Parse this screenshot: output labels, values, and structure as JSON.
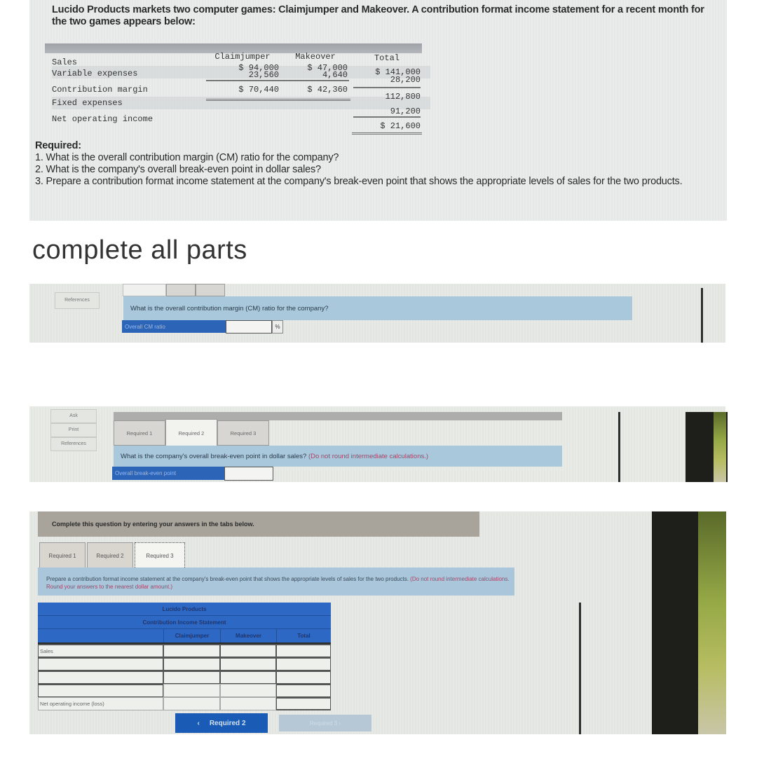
{
  "problem": {
    "intro": "Lucido Products markets two computer games: Claimjumper and Makeover. A contribution format income statement for a recent month for the two games appears below:",
    "statement": {
      "columns": [
        "Claimjumper",
        "Makeover",
        "Total"
      ],
      "rows": [
        {
          "label": "Sales",
          "claimjumper": "$ 94,000",
          "makeover": "$ 47,000",
          "total": "$ 141,000"
        },
        {
          "label": "Variable expenses",
          "claimjumper": "23,560",
          "makeover": "4,640",
          "total": "28,200"
        },
        {
          "label": "Contribution margin",
          "claimjumper": "$ 70,440",
          "makeover": "$ 42,360",
          "total": "112,800"
        },
        {
          "label": "Fixed expenses",
          "claimjumper": "",
          "makeover": "",
          "total": "91,200"
        },
        {
          "label": "Net operating income",
          "claimjumper": "",
          "makeover": "",
          "total": "$ 21,600"
        }
      ]
    },
    "required_heading": "Required:",
    "required_items": [
      "1. What is the overall contribution margin (CM) ratio for the company?",
      "2. What is the company's overall break-even point in dollar sales?",
      "3. Prepare a contribution format income statement at the company's break-even point that shows the appropriate levels of sales for the two products."
    ]
  },
  "caption": "complete all parts",
  "part1": {
    "side_buttons": [
      "References"
    ],
    "question": "What is the overall contribution margin (CM) ratio for the company?",
    "input_label": "Overall CM ratio",
    "input_value": "",
    "unit": "%"
  },
  "part2": {
    "side_buttons": [
      "Ask",
      "Print",
      "References"
    ],
    "tabs": [
      "Required 1",
      "Required 2",
      "Required 3"
    ],
    "active_tab": "Required 2",
    "question": "What is the company's overall break-even point in dollar sales?",
    "note": "(Do not round intermediate calculations.)",
    "input_label": "Overall break-even point",
    "input_value": ""
  },
  "part3": {
    "instruction_bar": "Complete this question by entering your answers in the tabs below.",
    "tabs": [
      "Required 1",
      "Required 2",
      "Required 3"
    ],
    "active_tab": "Required 3",
    "question": "Prepare a contribution format income statement at the company's break-even point that shows the appropriate levels of sales for the two products.",
    "note": "(Do not round intermediate calculations. Round your answers to the nearest dollar amount.)",
    "table": {
      "title": "Lucido Products",
      "subtitle": "Contribution Income Statement",
      "columns": [
        "Claimjumper",
        "Makeover",
        "Total"
      ],
      "rows": [
        {
          "label": "Sales"
        },
        {
          "label": ""
        },
        {
          "label": ""
        },
        {
          "label": ""
        },
        {
          "label": "Net operating income (loss)"
        }
      ]
    },
    "prev_button": "Required 2",
    "prev_icon": "‹",
    "next_button": "Required 3",
    "next_icon": "›"
  },
  "colors": {
    "accent_blue": "#2d69c4",
    "question_bar": "#a9c8dc",
    "button_blue": "#1a5cb5"
  }
}
